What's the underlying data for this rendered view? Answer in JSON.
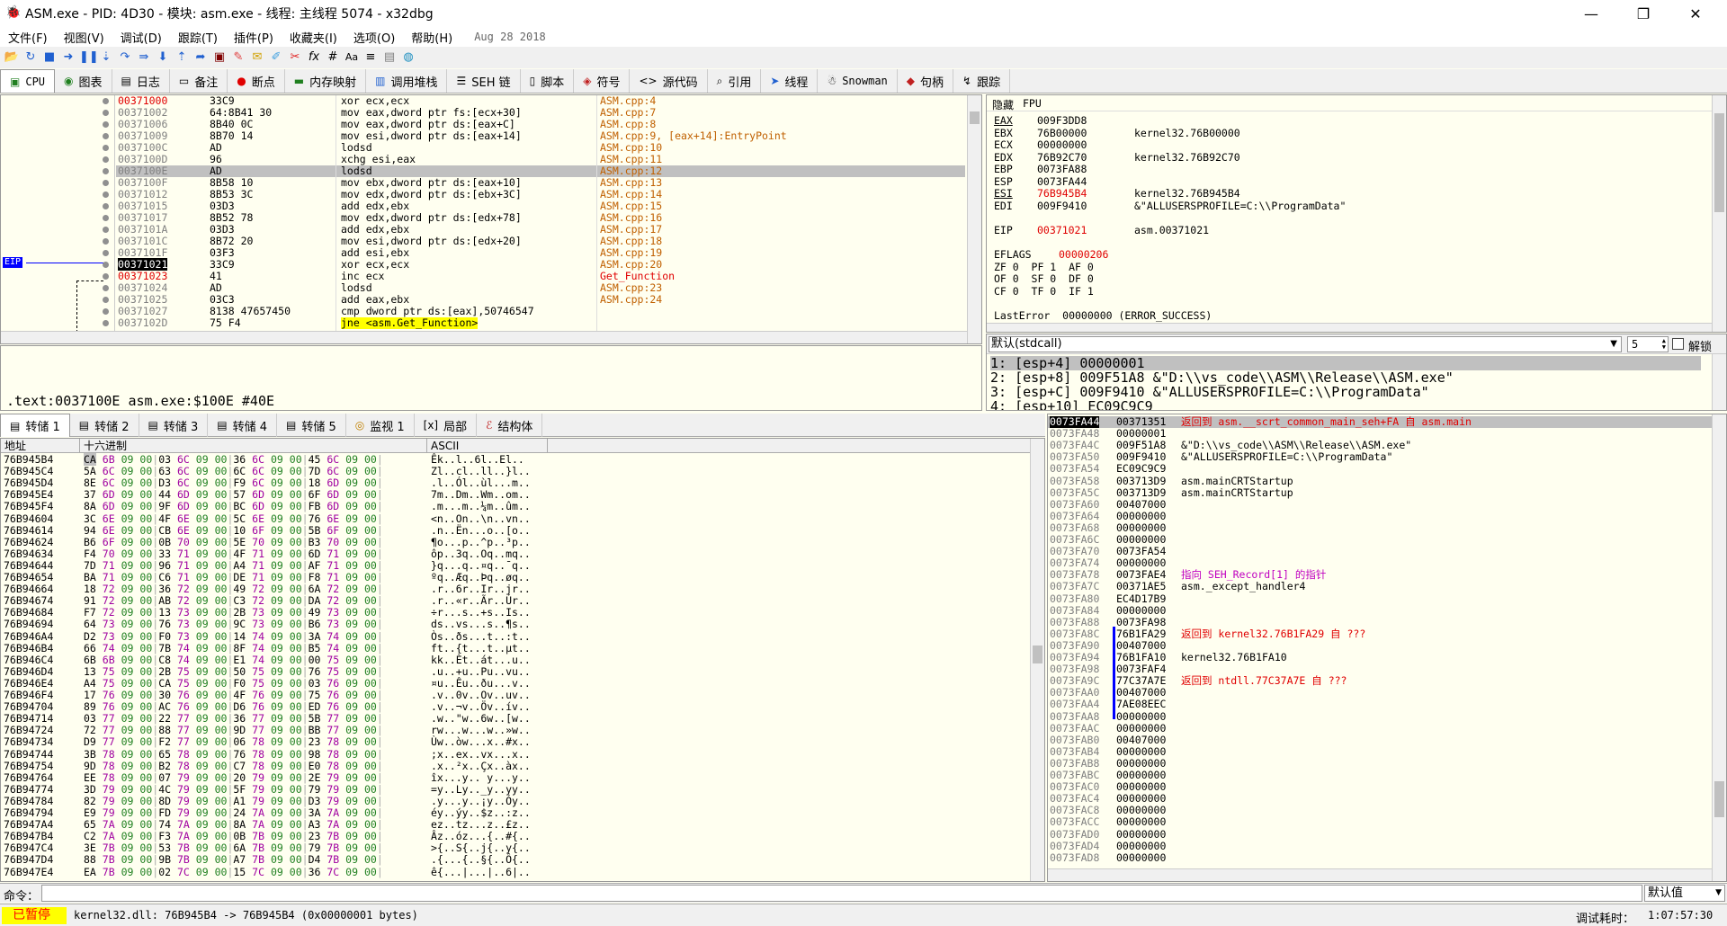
{
  "window": {
    "title": "ASM.exe - PID: 4D30 - 模块: asm.exe - 线程: 主线程 5074 - x32dbg"
  },
  "menu": {
    "items": [
      "文件(F)",
      "视图(V)",
      "调试(D)",
      "跟踪(T)",
      "插件(P)",
      "收藏夹(I)",
      "选项(O)",
      "帮助(H)"
    ],
    "date": "Aug 28 2018"
  },
  "tabs": [
    {
      "label": "CPU",
      "icon": "cpu-icon"
    },
    {
      "label": "图表",
      "icon": "graph-icon"
    },
    {
      "label": "日志",
      "icon": "log-icon"
    },
    {
      "label": "备注",
      "icon": "notes-icon"
    },
    {
      "label": "断点",
      "icon": "breakpoint-icon"
    },
    {
      "label": "内存映射",
      "icon": "memory-map-icon"
    },
    {
      "label": "调用堆栈",
      "icon": "call-stack-icon"
    },
    {
      "label": "SEH 链",
      "icon": "seh-icon"
    },
    {
      "label": "脚本",
      "icon": "script-icon"
    },
    {
      "label": "符号",
      "icon": "symbols-icon"
    },
    {
      "label": "源代码",
      "icon": "source-icon"
    },
    {
      "label": "引用",
      "icon": "references-icon"
    },
    {
      "label": "线程",
      "icon": "threads-icon"
    },
    {
      "label": "Snowman",
      "icon": "snowman-icon"
    },
    {
      "label": "句柄",
      "icon": "handles-icon"
    },
    {
      "label": "跟踪",
      "icon": "trace-icon"
    }
  ],
  "disasm": {
    "eip_label": "EIP",
    "rows": [
      {
        "addr": "00371000",
        "bytes": "33C9",
        "instr": "xor ecx,ecx",
        "comment": "ASM.cpp:4"
      },
      {
        "addr": "00371002",
        "bytes": "64:8B41 30",
        "instr": "mov eax,dword ptr fs:[ecx+30]",
        "comment": "ASM.cpp:7"
      },
      {
        "addr": "00371006",
        "bytes": "8B40 0C",
        "instr": "mov eax,dword ptr ds:[eax+C]",
        "comment": "ASM.cpp:8"
      },
      {
        "addr": "00371009",
        "bytes": "8B70 14",
        "instr": "mov esi,dword ptr ds:[eax+14]",
        "comment": "ASM.cpp:9, [eax+14]:EntryPoint"
      },
      {
        "addr": "0037100C",
        "bytes": "AD",
        "instr": "lodsd",
        "comment": "ASM.cpp:10"
      },
      {
        "addr": "0037100D",
        "bytes": "96",
        "instr": "xchg esi,eax",
        "comment": "ASM.cpp:11"
      },
      {
        "addr": "0037100E",
        "bytes": "AD",
        "instr": "lodsd",
        "comment": "ASM.cpp:12"
      },
      {
        "addr": "0037100F",
        "bytes": "8B58 10",
        "instr": "mov ebx,dword ptr ds:[eax+10]",
        "comment": "ASM.cpp:13"
      },
      {
        "addr": "00371012",
        "bytes": "8B53 3C",
        "instr": "mov edx,dword ptr ds:[ebx+3C]",
        "comment": "ASM.cpp:14"
      },
      {
        "addr": "00371015",
        "bytes": "03D3",
        "instr": "add edx,ebx",
        "comment": "ASM.cpp:15"
      },
      {
        "addr": "00371017",
        "bytes": "8B52 78",
        "instr": "mov edx,dword ptr ds:[edx+78]",
        "comment": "ASM.cpp:16"
      },
      {
        "addr": "0037101A",
        "bytes": "03D3",
        "instr": "add edx,ebx",
        "comment": "ASM.cpp:17"
      },
      {
        "addr": "0037101C",
        "bytes": "8B72 20",
        "instr": "mov esi,dword ptr ds:[edx+20]",
        "comment": "ASM.cpp:18"
      },
      {
        "addr": "0037101F",
        "bytes": "03F3",
        "instr": "add esi,ebx",
        "comment": "ASM.cpp:19"
      },
      {
        "addr": "00371021",
        "bytes": "33C9",
        "instr": "xor ecx,ecx",
        "comment": "ASM.cpp:20"
      },
      {
        "addr": "00371023",
        "bytes": "41",
        "instr": "inc ecx",
        "comment": "Get_Function"
      },
      {
        "addr": "00371024",
        "bytes": "AD",
        "instr": "lodsd",
        "comment": "ASM.cpp:23"
      },
      {
        "addr": "00371025",
        "bytes": "03C3",
        "instr": "add eax,ebx",
        "comment": "ASM.cpp:24"
      },
      {
        "addr": "00371027",
        "bytes": "8138 47657450",
        "instr": "cmp dword ptr ds:[eax],50746547",
        "comment": ""
      },
      {
        "addr": "0037102D",
        "bytes": "75 F4",
        "instr": "jne <asm.Get_Function>",
        "comment": ""
      }
    ]
  },
  "info_line": ".text:0037100E asm.exe:$100E #40E",
  "registers": {
    "header_hide": "隐藏",
    "header_fpu": "FPU",
    "regs": [
      {
        "name": "EAX",
        "val": "009F3DD8",
        "sym": ""
      },
      {
        "name": "EBX",
        "val": "76B00000",
        "sym": "kernel32.76B00000"
      },
      {
        "name": "ECX",
        "val": "00000000",
        "sym": ""
      },
      {
        "name": "EDX",
        "val": "76B92C70",
        "sym": "kernel32.76B92C70"
      },
      {
        "name": "EBP",
        "val": "0073FA88",
        "sym": ""
      },
      {
        "name": "ESP",
        "val": "0073FA44",
        "sym": ""
      },
      {
        "name": "ESI",
        "val": "76B945B4",
        "sym": "kernel32.76B945B4"
      },
      {
        "name": "EDI",
        "val": "009F9410",
        "sym": "&\"ALLUSERSPROFILE=C:\\\\ProgramData\""
      }
    ],
    "eip": {
      "name": "EIP",
      "val": "00371021",
      "sym": "asm.00371021"
    },
    "eflags": {
      "name": "EFLAGS",
      "val": "00000206"
    },
    "flags_rows": [
      "ZF 0  PF 1  AF 0",
      "OF 0  SF 0  DF 0",
      "CF 0  TF 0  IF 1"
    ],
    "lasterror": "LastError  00000000 (ERROR_SUCCESS)"
  },
  "callconv": {
    "selected": "默认(stdcall)",
    "count": "5",
    "unlock": "解锁",
    "args": [
      "1: [esp+4] 00000001",
      "2: [esp+8] 009F51A8 &\"D:\\\\vs_code\\\\ASM\\\\Release\\\\ASM.exe\"",
      "3: [esp+C] 009F9410 &\"ALLUSERSPROFILE=C:\\\\ProgramData\"",
      "4: [esp+10] EC09C9C9"
    ]
  },
  "dump_tabs": [
    "转储 1",
    "转储 2",
    "转储 3",
    "转储 4",
    "转储 5",
    "监视 1",
    "局部",
    "结构体"
  ],
  "dump": {
    "col_addr": "地址",
    "col_hex": "十六进制",
    "col_ascii": "ASCII",
    "rows": [
      [
        "76B945B4",
        "CA 6B 09 00 03 6C 09 00 36 6C 09 00 45 6C 09 00",
        "Êk..l..6l..El.."
      ],
      [
        "76B945C4",
        "5A 6C 09 00 63 6C 09 00 6C 6C 09 00 7D 6C 09 00",
        "Zl..cl..ll..}l.."
      ],
      [
        "76B945D4",
        "8E 6C 09 00 D3 6C 09 00 F9 6C 09 00 18 6D 09 00",
        ".l..Ól..ùl...m.."
      ],
      [
        "76B945E4",
        "37 6D 09 00 44 6D 09 00 57 6D 09 00 6F 6D 09 00",
        "7m..Dm..Wm..om.."
      ],
      [
        "76B945F4",
        "8A 6D 09 00 9F 6D 09 00 BC 6D 09 00 FB 6D 09 00",
        ".m...m..¼m..ûm.."
      ],
      [
        "76B94604",
        "3C 6E 09 00 4F 6E 09 00 5C 6E 09 00 76 6E 09 00",
        "<n..On..\\n..vn.."
      ],
      [
        "76B94614",
        "94 6E 09 00 CB 6E 09 00 10 6F 09 00 5B 6F 09 00",
        ".n..Ën...o..[o.."
      ],
      [
        "76B94624",
        "B6 6F 09 00 0B 70 09 00 5E 70 09 00 B3 70 09 00",
        "¶o...p..^p..³p.."
      ],
      [
        "76B94634",
        "F4 70 09 00 33 71 09 00 4F 71 09 00 6D 71 09 00",
        "ôp..3q..Oq..mq.."
      ],
      [
        "76B94644",
        "7D 71 09 00 96 71 09 00 A4 71 09 00 AF 71 09 00",
        "}q...q..¤q..¯q.."
      ],
      [
        "76B94654",
        "BA 71 09 00 C6 71 09 00 DE 71 09 00 F8 71 09 00",
        "ºq..Æq..Þq..øq.."
      ],
      [
        "76B94664",
        "18 72 09 00 36 72 09 00 49 72 09 00 6A 72 09 00",
        ".r..6r..Ir..jr.."
      ],
      [
        "76B94674",
        "91 72 09 00 AB 72 09 00 C3 72 09 00 DA 72 09 00",
        ".r..«r..Ãr..Úr.."
      ],
      [
        "76B94684",
        "F7 72 09 00 13 73 09 00 2B 73 09 00 49 73 09 00",
        "÷r...s..+s..Is.."
      ],
      [
        "76B94694",
        "64 73 09 00 76 73 09 00 9C 73 09 00 B6 73 09 00",
        "ds..vs...s..¶s.."
      ],
      [
        "76B946A4",
        "D2 73 09 00 F0 73 09 00 14 74 09 00 3A 74 09 00",
        "Òs..ðs...t..:t.."
      ],
      [
        "76B946B4",
        "66 74 09 00 7B 74 09 00 8F 74 09 00 B5 74 09 00",
        "ft..{t...t..µt.."
      ],
      [
        "76B946C4",
        "6B 6B 09 00 C8 74 09 00 E1 74 09 00 00 75 09 00",
        "kk..Èt..át...u.."
      ],
      [
        "76B946D4",
        "13 75 09 00 2B 75 09 00 50 75 09 00 76 75 09 00",
        ".u..+u..Pu..vu.."
      ],
      [
        "76B946E4",
        "A4 75 09 00 CA 75 09 00 F0 75 09 00 03 76 09 00",
        "¤u..Êu..ðu...v.."
      ],
      [
        "76B946F4",
        "17 76 09 00 30 76 09 00 4F 76 09 00 75 76 09 00",
        ".v..0v..Ov..uv.."
      ],
      [
        "76B94704",
        "89 76 09 00 AC 76 09 00 D6 76 09 00 ED 76 09 00",
        ".v..¬v..Öv..ív.."
      ],
      [
        "76B94714",
        "03 77 09 00 22 77 09 00 36 77 09 00 5B 77 09 00",
        ".w..\"w..6w..[w.."
      ],
      [
        "76B94724",
        "72 77 09 00 88 77 09 00 9D 77 09 00 BB 77 09 00",
        "rw...w...w..»w.."
      ],
      [
        "76B94734",
        "D9 77 09 00 F2 77 09 00 06 78 09 00 23 78 09 00",
        "Ùw..òw...x..#x.."
      ],
      [
        "76B94744",
        "3B 78 09 00 65 78 09 00 76 78 09 00 98 78 09 00",
        ";x..ex..vx...x.."
      ],
      [
        "76B94754",
        "9D 78 09 00 B2 78 09 00 C7 78 09 00 E0 78 09 00",
        ".x..²x..Çx..àx.."
      ],
      [
        "76B94764",
        "EE 78 09 00 07 79 09 00 20 79 09 00 2E 79 09 00",
        "îx...y.. y...y.."
      ],
      [
        "76B94774",
        "3D 79 09 00 4C 79 09 00 5F 79 09 00 79 79 09 00",
        "=y..Ly.._y..yy.."
      ],
      [
        "76B94784",
        "82 79 09 00 8D 79 09 00 A1 79 09 00 D3 79 09 00",
        ".y...y..¡y..Óy.."
      ],
      [
        "76B94794",
        "E9 79 09 00 FD 79 09 00 24 7A 09 00 3A 7A 09 00",
        "éy..ýy..$z..:z.."
      ],
      [
        "76B947A4",
        "65 7A 09 00 74 7A 09 00 8A 7A 09 00 A3 7A 09 00",
        "ez..tz...z..£z.."
      ],
      [
        "76B947B4",
        "C2 7A 09 00 F3 7A 09 00 0B 7B 09 00 23 7B 09 00",
        "Âz..óz...{..#{.."
      ],
      [
        "76B947C4",
        "3E 7B 09 00 53 7B 09 00 6A 7B 09 00 79 7B 09 00",
        ">{..S{..j{..y{.."
      ],
      [
        "76B947D4",
        "88 7B 09 00 9B 7B 09 00 A7 7B 09 00 D4 7B 09 00",
        ".{...{..§{..Ô{.."
      ],
      [
        "76B947E4",
        "EA 7B 09 00 02 7C 09 00 15 7C 09 00 36 7C 09 00",
        "ê{...|...|..6|.."
      ]
    ]
  },
  "stack": {
    "rows": [
      {
        "addr": "0073FA44",
        "val": "00371351",
        "cm": "返回到 asm.__scrt_common_main_seh+FA 自 asm.main",
        "cc": "red"
      },
      {
        "addr": "0073FA48",
        "val": "00000001",
        "cm": "",
        "cc": ""
      },
      {
        "addr": "0073FA4C",
        "val": "009F51A8",
        "cm": "&\"D:\\\\vs_code\\\\ASM\\\\Release\\\\ASM.exe\"",
        "cc": ""
      },
      {
        "addr": "0073FA50",
        "val": "009F9410",
        "cm": "&\"ALLUSERSPROFILE=C:\\\\ProgramData\"",
        "cc": ""
      },
      {
        "addr": "0073FA54",
        "val": "EC09C9C9",
        "cm": "",
        "cc": ""
      },
      {
        "addr": "0073FA58",
        "val": "003713D9",
        "cm": "asm.mainCRTStartup",
        "cc": ""
      },
      {
        "addr": "0073FA5C",
        "val": "003713D9",
        "cm": "asm.mainCRTStartup",
        "cc": ""
      },
      {
        "addr": "0073FA60",
        "val": "00407000",
        "cm": "",
        "cc": ""
      },
      {
        "addr": "0073FA64",
        "val": "00000000",
        "cm": "",
        "cc": ""
      },
      {
        "addr": "0073FA68",
        "val": "00000000",
        "cm": "",
        "cc": ""
      },
      {
        "addr": "0073FA6C",
        "val": "00000000",
        "cm": "",
        "cc": ""
      },
      {
        "addr": "0073FA70",
        "val": "0073FA54",
        "cm": "",
        "cc": ""
      },
      {
        "addr": "0073FA74",
        "val": "00000000",
        "cm": "",
        "cc": ""
      },
      {
        "addr": "0073FA78",
        "val": "0073FAE4",
        "cm": "指向 SEH_Record[1] 的指针",
        "cc": "mag"
      },
      {
        "addr": "0073FA7C",
        "val": "00371AE5",
        "cm": "asm._except_handler4",
        "cc": ""
      },
      {
        "addr": "0073FA80",
        "val": "EC4D17B9",
        "cm": "",
        "cc": ""
      },
      {
        "addr": "0073FA84",
        "val": "00000000",
        "cm": "",
        "cc": ""
      },
      {
        "addr": "0073FA88",
        "val": "0073FA98",
        "cm": "",
        "cc": ""
      },
      {
        "addr": "0073FA8C",
        "val": "76B1FA29",
        "cm": "返回到 kernel32.76B1FA29 自 ???",
        "cc": "red"
      },
      {
        "addr": "0073FA90",
        "val": "00407000",
        "cm": "",
        "cc": ""
      },
      {
        "addr": "0073FA94",
        "val": "76B1FA10",
        "cm": "kernel32.76B1FA10",
        "cc": ""
      },
      {
        "addr": "0073FA98",
        "val": "0073FAF4",
        "cm": "",
        "cc": ""
      },
      {
        "addr": "0073FA9C",
        "val": "77C37A7E",
        "cm": "返回到 ntdll.77C37A7E 自 ???",
        "cc": "red"
      },
      {
        "addr": "0073FAA0",
        "val": "00407000",
        "cm": "",
        "cc": ""
      },
      {
        "addr": "0073FAA4",
        "val": "7AE08EEC",
        "cm": "",
        "cc": ""
      },
      {
        "addr": "0073FAA8",
        "val": "00000000",
        "cm": "",
        "cc": ""
      },
      {
        "addr": "0073FAAC",
        "val": "00000000",
        "cm": "",
        "cc": ""
      },
      {
        "addr": "0073FAB0",
        "val": "00407000",
        "cm": "",
        "cc": ""
      },
      {
        "addr": "0073FAB4",
        "val": "00000000",
        "cm": "",
        "cc": ""
      },
      {
        "addr": "0073FAB8",
        "val": "00000000",
        "cm": "",
        "cc": ""
      },
      {
        "addr": "0073FABC",
        "val": "00000000",
        "cm": "",
        "cc": ""
      },
      {
        "addr": "0073FAC0",
        "val": "00000000",
        "cm": "",
        "cc": ""
      },
      {
        "addr": "0073FAC4",
        "val": "00000000",
        "cm": "",
        "cc": ""
      },
      {
        "addr": "0073FAC8",
        "val": "00000000",
        "cm": "",
        "cc": ""
      },
      {
        "addr": "0073FACC",
        "val": "00000000",
        "cm": "",
        "cc": ""
      },
      {
        "addr": "0073FAD0",
        "val": "00000000",
        "cm": "",
        "cc": ""
      },
      {
        "addr": "0073FAD4",
        "val": "00000000",
        "cm": "",
        "cc": ""
      },
      {
        "addr": "0073FAD8",
        "val": "00000000",
        "cm": "",
        "cc": ""
      }
    ]
  },
  "command": {
    "label": "命令：",
    "value": "",
    "default": "默认值"
  },
  "status": {
    "state": "已暂停",
    "message": "kernel32.dll: 76B945B4 -> 76B945B4 (0x00000001 bytes)",
    "time_label": "调试耗时：",
    "time_value": "1:07:57:30"
  },
  "colors": {
    "paused_bg": "#ffff00",
    "paused_fg": "#ff0000",
    "eip_bg": "#0000ff",
    "accent_red": "#e00000"
  }
}
